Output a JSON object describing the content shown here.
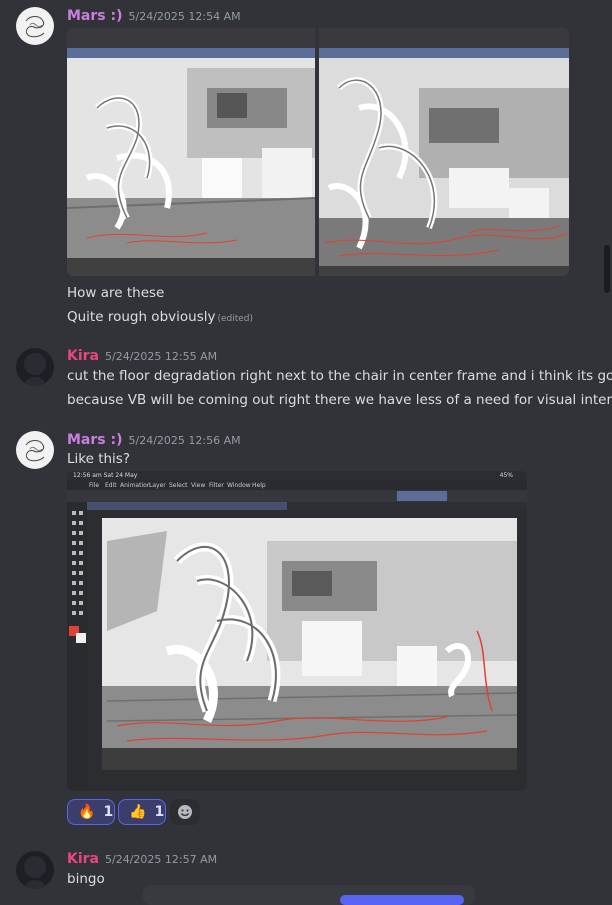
{
  "messages": [
    {
      "author": "Mars :)",
      "timestamp": "5/24/2025 12:54 AM",
      "lines": [
        "How are these",
        "Quite rough obviously"
      ],
      "edited_label": "(edited)",
      "attachments": [
        "sketch-image-left",
        "sketch-image-right"
      ]
    },
    {
      "author": "Kira",
      "timestamp": "5/24/2025 12:55 AM",
      "lines": [
        "cut the floor degradation right next to the chair in center frame and i think its good",
        "because VB will be coming out right there we have less of a need for visual interest"
      ]
    },
    {
      "author": "Mars :)",
      "timestamp": "5/24/2025 12:56 AM",
      "lines": [
        "Like this?"
      ],
      "attachments": [
        "ipad-screenshot"
      ],
      "screenshot": {
        "status_time": "12:56 am  Sat 24 May",
        "battery": "45%",
        "menu": [
          "File",
          "Edit",
          "Animation",
          "Layer",
          "Select",
          "View",
          "Filter",
          "Window",
          "Help"
        ]
      },
      "reactions": [
        {
          "emoji": "🔥",
          "count": "1"
        },
        {
          "emoji": "👍",
          "count": "1"
        }
      ]
    },
    {
      "author": "Kira",
      "timestamp": "5/24/2025 12:57 AM",
      "lines": [
        "bingo"
      ]
    }
  ],
  "colors": {
    "background": "#313338",
    "mars_name": "#c97fe0",
    "kira_name": "#e8467c",
    "reaction_bg": "#3b3e6b",
    "reaction_border": "#5865f2",
    "sketch_red": "#e0422f"
  },
  "icons": [
    "emoji-add-icon",
    "fire-emoji-icon",
    "thumbs-up-emoji-icon"
  ]
}
